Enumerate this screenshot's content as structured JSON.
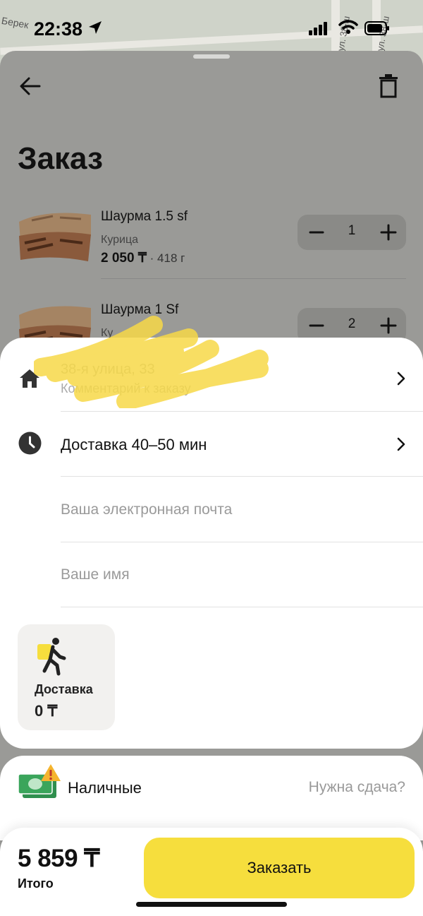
{
  "status_bar": {
    "time": "22:38"
  },
  "map": {
    "street_1": "ул. 38-ш",
    "street_2": "ул. 38-ш",
    "place": "Берек"
  },
  "order": {
    "title": "Заказ",
    "items": [
      {
        "name": "Шаурма 1.5 sf",
        "modifier": "Курица",
        "price": "2 050 ₸",
        "weight": " · 418 г",
        "quantity": "1"
      },
      {
        "name": "Шаурма 1 Sf",
        "modifier": "Ку",
        "quantity": "2"
      }
    ]
  },
  "details": {
    "address": "38-я улица, 33",
    "address_comment": "Комментарий к заказу",
    "delivery_time": "Доставка 40–50 мин",
    "email_placeholder": "Ваша электронная почта",
    "name_placeholder": "Ваше имя",
    "delivery_tile": {
      "label": "Доставка",
      "price": "0 ₸"
    }
  },
  "payment": {
    "method": "Наличные",
    "change_link": "Нужна сдача?"
  },
  "footer": {
    "total": "5 859 ₸",
    "total_label": "Итого",
    "order_button": "Заказать"
  },
  "colors": {
    "accent": "#f6de3d",
    "overlay": "#9a9a97",
    "card": "#ffffff",
    "money_green": "#3aa55b",
    "warning": "#f5b52e"
  }
}
